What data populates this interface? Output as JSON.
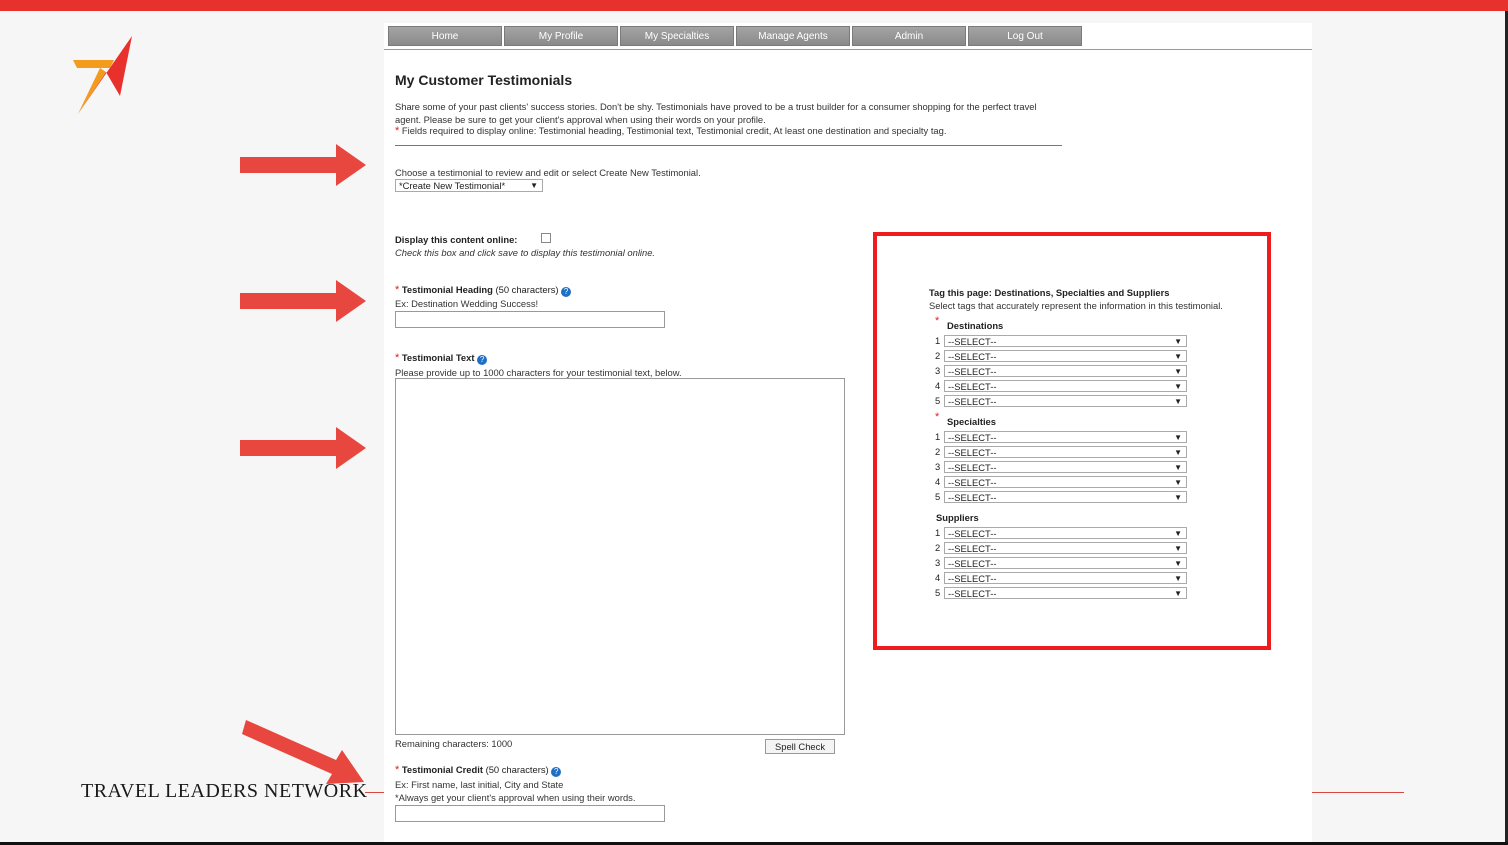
{
  "nav": [
    "Home",
    "My Profile",
    "My Specialties",
    "Manage Agents",
    "Admin",
    "Log Out"
  ],
  "brand": "TRAVEL LEADERS NETWORK",
  "page": {
    "title": "My Customer Testimonials",
    "intro": "Share some of your past clients' success stories. Don't be shy. Testimonials have proved to be a trust builder for a consumer shopping for the perfect travel agent. Please be sure to get your client's approval when using their words on your profile.",
    "required_star": "*",
    "required_note": "Fields required to display online: Testimonial heading, Testimonial text, Testimonial credit, At least one destination and specialty tag.",
    "choose_label": "Choose a testimonial to review and edit or select Create New Testimonial.",
    "choose_value": "*Create New Testimonial*",
    "display_label": "Display this content online:",
    "display_hint": "Check this box and click save to display this testimonial online.",
    "heading_title": "Testimonial Heading",
    "heading_limit": "(50 characters)",
    "heading_example": "Ex: Destination Wedding Success!",
    "text_title": "Testimonial Text",
    "text_hint": "Please provide up to 1000 characters for your testimonial text, below.",
    "remaining": "Remaining characters: 1000",
    "spell_check": "Spell Check",
    "credit_title": "Testimonial Credit",
    "credit_limit": "(50 characters)",
    "credit_example": "Ex: First name, last initial, City and State",
    "credit_note": "*Always get your client's approval when using their words.",
    "help_glyph": "?",
    "caret": "▼"
  },
  "tags": {
    "title": "Tag this page: Destinations, Specialties and Suppliers",
    "subtitle": "Select tags that accurately represent the information in this testimonial.",
    "groups": [
      {
        "label": "Destinations",
        "required": true,
        "options": [
          "--SELECT--",
          "--SELECT--",
          "--SELECT--",
          "--SELECT--",
          "--SELECT--"
        ]
      },
      {
        "label": "Specialties",
        "required": true,
        "options": [
          "--SELECT--",
          "--SELECT--",
          "--SELECT--",
          "--SELECT--",
          "--SELECT--"
        ]
      },
      {
        "label": "Suppliers",
        "required": false,
        "options": [
          "--SELECT--",
          "--SELECT--",
          "--SELECT--",
          "--SELECT--",
          "--SELECT--"
        ]
      }
    ]
  },
  "colors": {
    "accent_red": "#ee1c1c",
    "top_bar": "#e8302c",
    "arrow": "#e8473f",
    "nav_gray": "#9a9a9a",
    "help_blue": "#1f6fc4"
  }
}
